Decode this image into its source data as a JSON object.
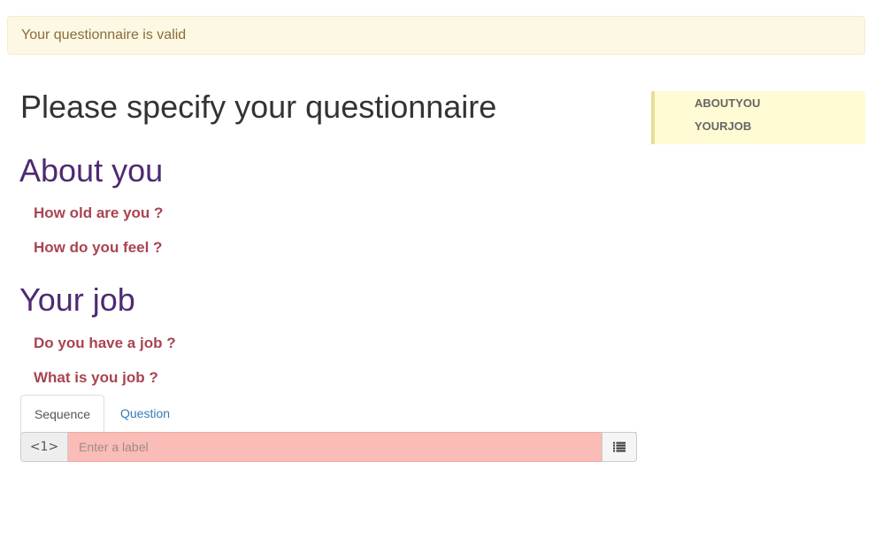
{
  "alert": {
    "text": "Your questionnaire is valid"
  },
  "page": {
    "title": "Please specify your questionnaire"
  },
  "sections": [
    {
      "title": "About you",
      "questions": [
        "How old are you ?",
        "How do you feel ?"
      ]
    },
    {
      "title": "Your job",
      "questions": [
        "Do you have a job ?",
        "What is you job ?"
      ]
    }
  ],
  "tabs": [
    {
      "label": "Sequence",
      "active": true
    },
    {
      "label": "Question",
      "active": false
    }
  ],
  "label_input": {
    "addon": "<1>",
    "placeholder": "Enter a label",
    "value": "",
    "icon": "list-icon"
  },
  "side_nav": {
    "items": [
      "ABOUTYOU",
      "YOURJOB"
    ]
  },
  "colors": {
    "alert_bg": "#fcf8e3",
    "section_title": "#4e2a72",
    "question": "#a94450",
    "input_error_bg": "#f9bcb6",
    "side_nav_bg": "#fffbd5"
  }
}
